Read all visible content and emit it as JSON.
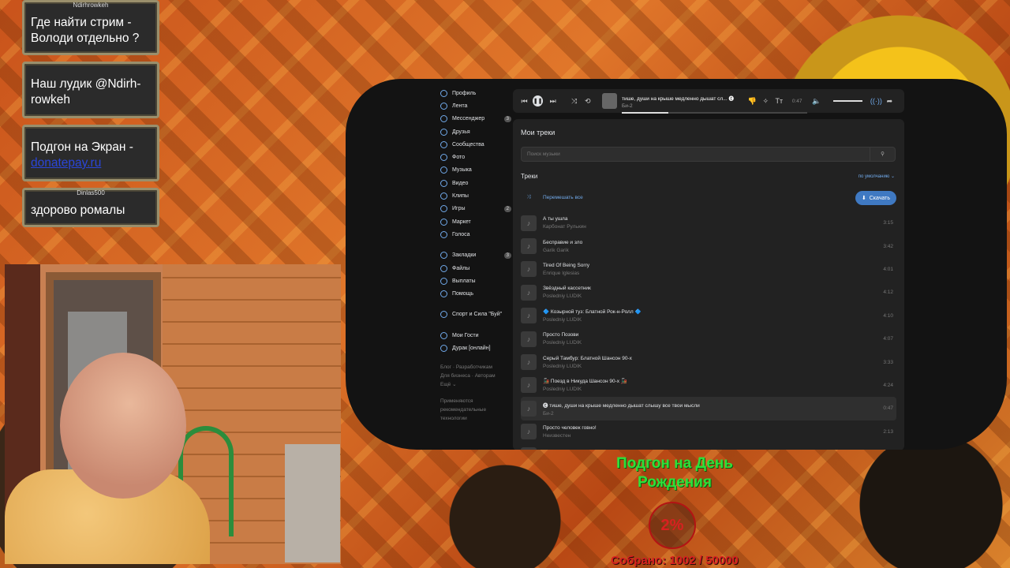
{
  "chat": [
    {
      "nick": "Ndirhrowkeh",
      "text": "Где найти стрим - Володи отдельно ?"
    },
    {
      "nick": "",
      "text": "Наш лудик @Ndirh-rowkeh"
    },
    {
      "nick": "",
      "text": "Подгон на Экран -",
      "link": "donatepay.ru"
    },
    {
      "nick": "Dinlas500",
      "text": "здорово ромалы"
    }
  ],
  "sidebar": {
    "items": [
      {
        "label": "Профиль",
        "badge": ""
      },
      {
        "label": "Лента",
        "badge": ""
      },
      {
        "label": "Мессенджер",
        "badge": "3"
      },
      {
        "label": "Друзья",
        "badge": ""
      },
      {
        "label": "Сообщества",
        "badge": ""
      },
      {
        "label": "Фото",
        "badge": ""
      },
      {
        "label": "Музыка",
        "badge": ""
      },
      {
        "label": "Видео",
        "badge": ""
      },
      {
        "label": "Клипы",
        "badge": ""
      },
      {
        "label": "Игры",
        "badge": "2"
      },
      {
        "label": "Маркет",
        "badge": ""
      },
      {
        "label": "Голоса",
        "badge": ""
      }
    ],
    "items2": [
      {
        "label": "Закладки",
        "badge": "3"
      },
      {
        "label": "Файлы",
        "badge": ""
      },
      {
        "label": "Выплаты",
        "badge": ""
      },
      {
        "label": "Помощь",
        "badge": ""
      }
    ],
    "items3": [
      {
        "label": "Спорт и Сила \"Буй\""
      }
    ],
    "items4": [
      {
        "label": "Мои Гости"
      },
      {
        "label": "Дурак [онлайн]"
      }
    ],
    "footer1": "Блог · Разработчикам",
    "footer2": "Для бизнеса · Авторам",
    "footer3": "Ещё ⌄",
    "footer4": "Применяются рекомендательные технологии"
  },
  "player": {
    "title": "тише, души на крыше медленно дышат сл... 🅔",
    "artist": "Би-2",
    "time": "0:47",
    "progress": 0.25
  },
  "music": {
    "heading": "Мои треки",
    "search_placeholder": "Поиск музыки",
    "section": "Треки",
    "sort": "по умолчанию ⌄",
    "shuffle": "Перемешать все",
    "download": "Скачать",
    "tracks": [
      {
        "title": "А ты ушла",
        "artist": "Карбонат Рулькин",
        "duration": "3:15"
      },
      {
        "title": "Бесправие и зло",
        "artist": "Garik Garik",
        "duration": "3:42"
      },
      {
        "title": "Tired Of Being Sorry",
        "artist": "Enrique Iglesias",
        "duration": "4:01"
      },
      {
        "title": "Звёздный кассетник",
        "artist": "Posledniy LUDIK",
        "duration": "4:12"
      },
      {
        "title": "🔷 Козырной туз: Блатной Рок-н-Ролл 🔷",
        "artist": "Posledniy LUDIK",
        "duration": "4:10"
      },
      {
        "title": "Просто Позови",
        "artist": "Posledniy LUDIK",
        "duration": "4:07"
      },
      {
        "title": "Серый Тамбур: Блатной Шансон 90-х",
        "artist": "Posledniy LUDIK",
        "duration": "3:33"
      },
      {
        "title": "🚂 Поезд в Никуда Шансон 90-х 🚂",
        "artist": "Posledniy LUDIK",
        "duration": "4:24"
      },
      {
        "title": "🅔 тише, души на крыше медленно дышат слышу все твои мысли",
        "artist": "Би-2",
        "duration": "0:47"
      },
      {
        "title": "Просто человек говно!",
        "artist": "Неизвестен",
        "duration": "2:13"
      },
      {
        "title": "Я не буду ждать тебя [Я не стану ждать на берегу]",
        "artist": "",
        "duration": ""
      }
    ]
  },
  "goal": {
    "title": "Подгон на День Рождения",
    "percent": "2%",
    "collected": "Собрано: 1002 / 50000"
  }
}
